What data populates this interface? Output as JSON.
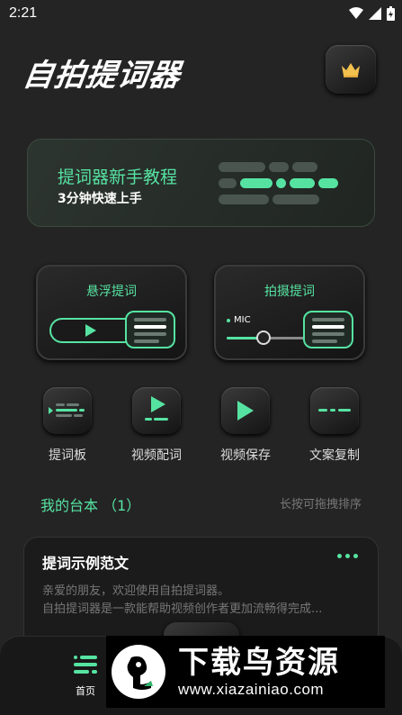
{
  "status_bar": {
    "time": "2:21"
  },
  "header": {
    "title": "自拍提词器",
    "vip_icon": "crown-icon"
  },
  "tutorial": {
    "title": "提词器新手教程",
    "subtitle": "3分钟快速上手"
  },
  "features": [
    {
      "label": "悬浮提词"
    },
    {
      "label": "拍摄提词",
      "mic_label": "MIC"
    }
  ],
  "tools": [
    {
      "label": "提词板",
      "icon": "board-icon"
    },
    {
      "label": "视频配词",
      "icon": "video-caption-icon"
    },
    {
      "label": "视频保存",
      "icon": "video-save-icon"
    },
    {
      "label": "文案复制",
      "icon": "copy-icon"
    }
  ],
  "scripts_section": {
    "title": "我的台本 （1）",
    "hint": "长按可拖拽排序"
  },
  "script_card": {
    "title": "提词示例范文",
    "lines": [
      "亲爱的朋友，欢迎使用自拍提词器。",
      "自拍提词器是一款能帮助视频创作者更加流畅得完成..."
    ]
  },
  "tabbar": {
    "home_label": "首页"
  },
  "watermark": {
    "name": "下载鸟资源",
    "url": "www.xiazainiao.com"
  },
  "colors": {
    "accent": "#56e3a2",
    "background": "#242424"
  }
}
